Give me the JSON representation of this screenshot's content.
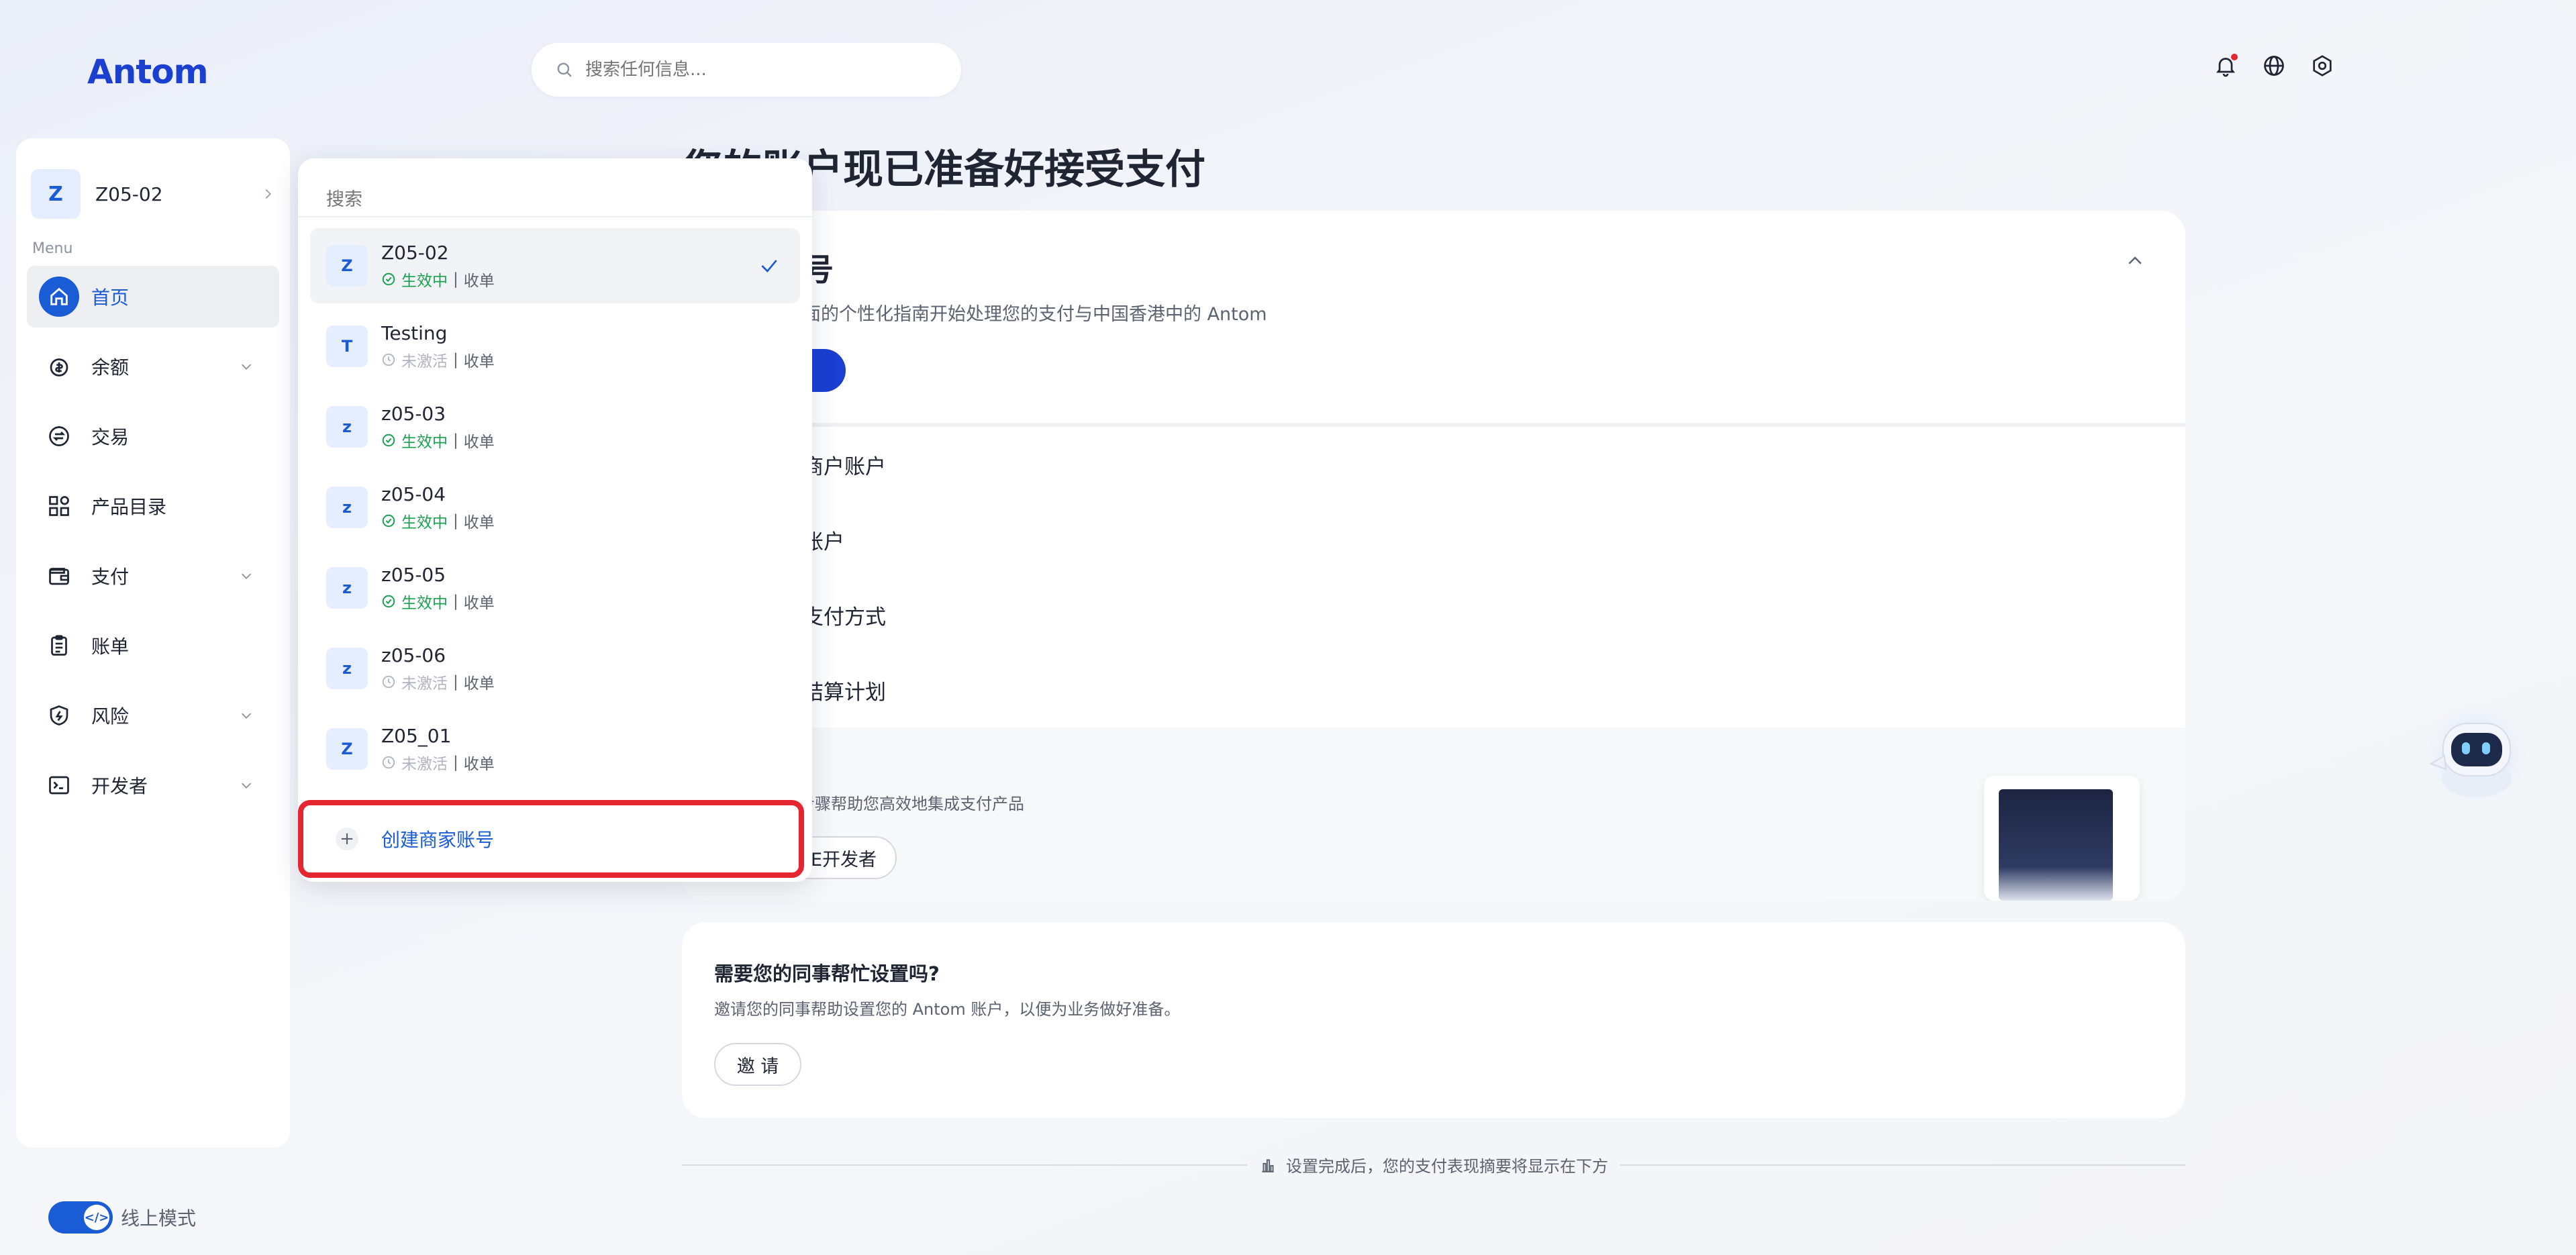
{
  "header": {
    "logo": "Antom",
    "search_placeholder": "搜索任何信息..."
  },
  "sidebar": {
    "account_initial": "Z",
    "account_name": "Z05-02",
    "menu_label": "Menu",
    "items": [
      {
        "label": "首页",
        "icon": "home-icon",
        "active": true
      },
      {
        "label": "余额",
        "icon": "wallet-coin-icon",
        "has_chevron": true
      },
      {
        "label": "交易",
        "icon": "exchange-icon"
      },
      {
        "label": "产品目录",
        "icon": "grid-icon"
      },
      {
        "label": "支付",
        "icon": "wallet-icon",
        "has_chevron": true
      },
      {
        "label": "账单",
        "icon": "clipboard-icon"
      },
      {
        "label": "风险",
        "icon": "shield-icon",
        "has_chevron": true
      },
      {
        "label": "开发者",
        "icon": "terminal-icon",
        "has_chevron": true
      }
    ],
    "mode_label": "线上模式"
  },
  "main": {
    "title": "您的账户现已准备好接受支付",
    "guide": {
      "title": "号",
      "desc": "面的个性化指南开始处理您的支付与中国香港中的 Antom",
      "steps": [
        "商户账户",
        "账户",
        "支付方式",
        "结算计划"
      ]
    },
    "developer": {
      "desc": "行的步骤帮助您高效地集成支付产品",
      "button": "E开发者"
    },
    "colleague": {
      "title": "需要您的同事帮忙设置吗?",
      "desc": "邀请您的同事帮助设置您的 Antom 账户，以便为业务做好准备。",
      "button": "邀 请"
    },
    "footer_note": "设置完成后，您的支付表现摘要将显示在下方"
  },
  "dropdown": {
    "search_placeholder": "搜索",
    "accounts": [
      {
        "initial": "Z",
        "name": "Z05-02",
        "status": "生效中",
        "type": "收单",
        "active": true,
        "selected": true
      },
      {
        "initial": "T",
        "name": "Testing",
        "status": "未激活",
        "type": "收单",
        "active": false
      },
      {
        "initial": "z",
        "name": "z05-03",
        "status": "生效中",
        "type": "收单",
        "active": true
      },
      {
        "initial": "z",
        "name": "z05-04",
        "status": "生效中",
        "type": "收单",
        "active": true
      },
      {
        "initial": "z",
        "name": "z05-05",
        "status": "生效中",
        "type": "收单",
        "active": true
      },
      {
        "initial": "z",
        "name": "z05-06",
        "status": "未激活",
        "type": "收单",
        "active": false
      },
      {
        "initial": "Z",
        "name": "Z05_01",
        "status": "未激活",
        "type": "收单",
        "active": false
      }
    ],
    "create_label": "创建商家账号"
  },
  "colors": {
    "accent": "#1a5bd6",
    "active_status": "#1aa251",
    "highlight_border": "#e3262f"
  }
}
